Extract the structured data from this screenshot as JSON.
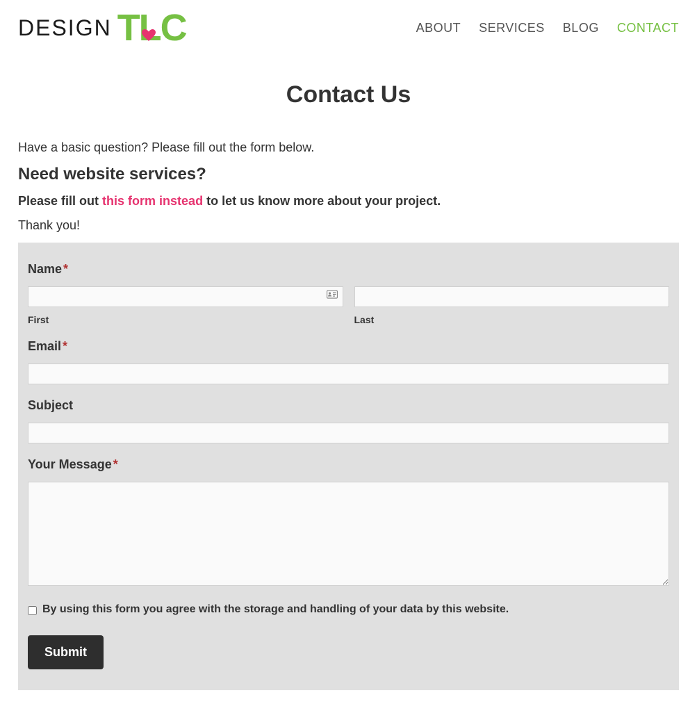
{
  "logo": {
    "design": "DESIGN",
    "tlc": "TLC"
  },
  "nav": {
    "about": "ABOUT",
    "services": "SERVICES",
    "blog": "BLOG",
    "contact": "CONTACT"
  },
  "page_title": "Contact Us",
  "intro": {
    "basic_question": "Have a basic question? Please fill out the form below.",
    "need_services_heading": "Need website services?",
    "please_fill_pre": "Please fill out ",
    "please_fill_link": "this form instead",
    "please_fill_post": " to let us know more about your project.",
    "thank_you": "Thank you!"
  },
  "form": {
    "name_label": "Name",
    "first_label": "First",
    "last_label": "Last",
    "email_label": "Email",
    "subject_label": "Subject",
    "message_label": "Your Message",
    "consent_label": "By using this form you agree with the storage and handling of your data by this website.",
    "submit_label": "Submit",
    "required_marker": "*"
  }
}
